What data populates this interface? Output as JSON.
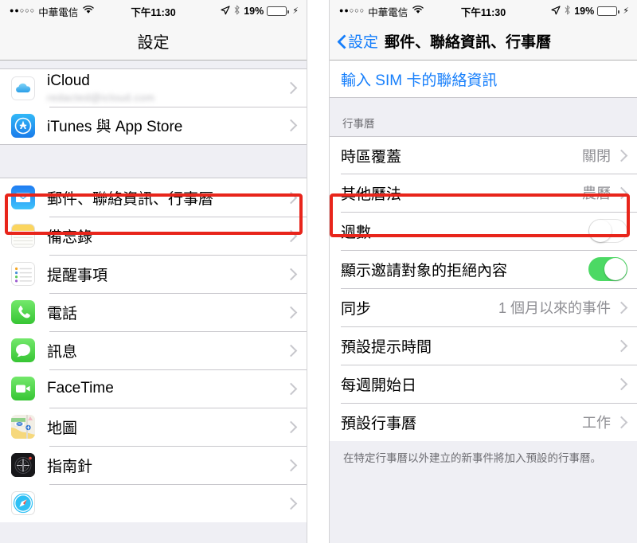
{
  "status_bar": {
    "signal_dots": "●●○○○",
    "carrier": "中華電信",
    "wifi_icon": "wifi-icon",
    "time": "下午11:30",
    "location_icon": "location-arrow-icon",
    "bluetooth_icon": "bluetooth-icon",
    "battery_percent": "19%",
    "battery_level": 19,
    "charging_icon": "lightning-bolt-icon"
  },
  "left_panel": {
    "nav": {
      "title": "設定"
    },
    "groups": [
      {
        "rows": [
          {
            "icon": "icloud-icon",
            "label": "iCloud",
            "subtitle": "redacted@icloud.com",
            "accessory": "chevron"
          },
          {
            "icon": "app-store-icon",
            "label": "iTunes 與 App Store",
            "accessory": "chevron"
          }
        ]
      },
      {
        "rows": [
          {
            "icon": "mail-icon",
            "label": "郵件、聯絡資訊、行事曆",
            "accessory": "chevron",
            "highlighted": true
          },
          {
            "icon": "notes-icon",
            "label": "備忘錄",
            "accessory": "chevron"
          },
          {
            "icon": "reminders-icon",
            "label": "提醒事項",
            "accessory": "chevron"
          },
          {
            "icon": "phone-icon",
            "label": "電話",
            "accessory": "chevron"
          },
          {
            "icon": "messages-icon",
            "label": "訊息",
            "accessory": "chevron"
          },
          {
            "icon": "facetime-icon",
            "label": "FaceTime",
            "accessory": "chevron"
          },
          {
            "icon": "maps-icon",
            "label": "地圖",
            "accessory": "chevron"
          },
          {
            "icon": "compass-icon",
            "label": "指南針",
            "accessory": "chevron"
          },
          {
            "icon": "safari-icon",
            "label": "",
            "accessory": "chevron"
          }
        ]
      }
    ]
  },
  "right_panel": {
    "nav": {
      "back_label": "設定",
      "title": "郵件、聯絡資訊、行事曆"
    },
    "sim_row": {
      "label": "輸入 SIM 卡的聯絡資訊"
    },
    "section_header": "行事曆",
    "rows": [
      {
        "label": "時區覆蓋",
        "value": "關閉",
        "accessory": "chevron"
      },
      {
        "label": "其他曆法",
        "value": "農曆",
        "accessory": "chevron",
        "highlighted": true
      },
      {
        "label": "週數",
        "accessory": "toggle",
        "toggle_on": false
      },
      {
        "label": "顯示邀請對象的拒絕內容",
        "accessory": "toggle",
        "toggle_on": true
      },
      {
        "label": "同步",
        "value": "1 個月以來的事件",
        "accessory": "chevron"
      },
      {
        "label": "預設提示時間",
        "accessory": "chevron"
      },
      {
        "label": "每週開始日",
        "accessory": "chevron"
      },
      {
        "label": "預設行事曆",
        "value": "工作",
        "accessory": "chevron"
      }
    ],
    "footer_note": "在特定行事曆以外建立的新事件將加入預設的行事曆。"
  },
  "colors": {
    "highlight_box": "#e8251b",
    "link_blue": "#157efb",
    "toggle_on_green": "#4cd964",
    "battery_red": "#ec3b2c",
    "list_background": "#efeff4",
    "value_gray": "#8e8e93"
  }
}
